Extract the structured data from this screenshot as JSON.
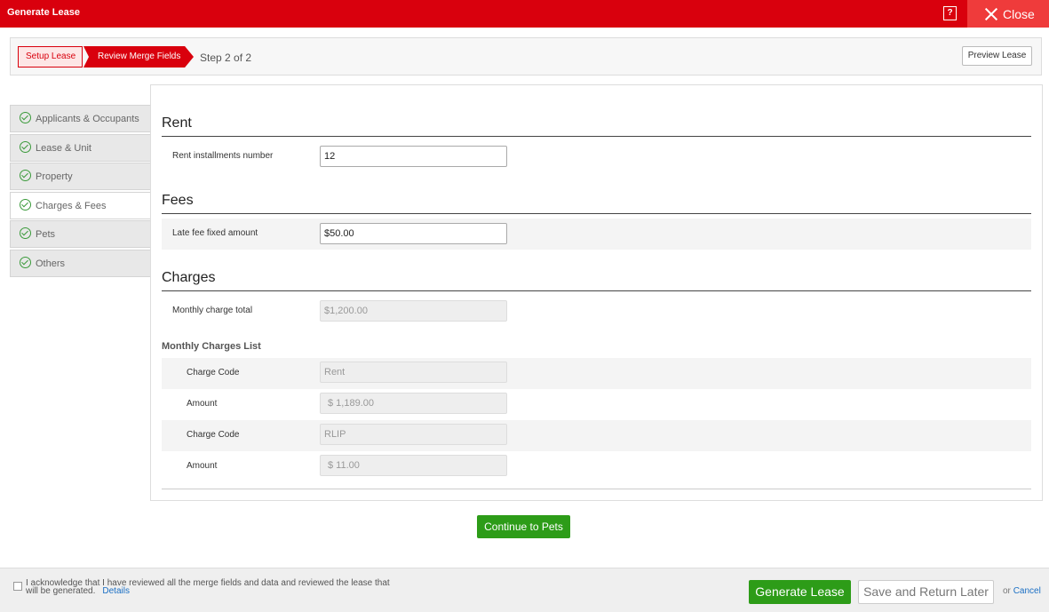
{
  "header": {
    "title": "Generate Lease",
    "help_icon": "?",
    "close_label": "Close"
  },
  "wizard": {
    "step1": "Setup Lease",
    "step2": "Review Merge Fields",
    "step_count": "Step 2 of 2",
    "preview_button": "Preview Lease"
  },
  "sidebar": {
    "items": [
      {
        "label": "Applicants & Occupants"
      },
      {
        "label": "Lease & Unit"
      },
      {
        "label": "Property"
      },
      {
        "label": "Charges & Fees"
      },
      {
        "label": "Pets"
      },
      {
        "label": "Others"
      }
    ]
  },
  "main": {
    "rent": {
      "title": "Rent",
      "installments_label": "Rent installments number",
      "installments_value": "12"
    },
    "fees": {
      "title": "Fees",
      "late_fee_label": "Late fee fixed amount",
      "late_fee_value": "$50.00"
    },
    "charges": {
      "title": "Charges",
      "monthly_total_label": "Monthly charge total",
      "monthly_total_placeholder": "$1,200.00",
      "list_heading": "Monthly Charges List",
      "items": [
        {
          "code_label": "Charge Code",
          "code_value": "Rent",
          "amount_label": "Amount",
          "amount_value": "$ 1,189.00"
        },
        {
          "code_label": "Charge Code",
          "code_value": "RLIP",
          "amount_label": "Amount",
          "amount_value": "$ 11.00"
        }
      ]
    },
    "continue_button": "Continue to Pets"
  },
  "footer": {
    "ack_text": "I acknowledge that I have reviewed all the merge fields and data and reviewed the lease that will be generated.",
    "details_link": "Details",
    "generate_button": "Generate Lease",
    "save_button": "Save and Return Later",
    "or_text": "or",
    "cancel_link": "Cancel"
  }
}
